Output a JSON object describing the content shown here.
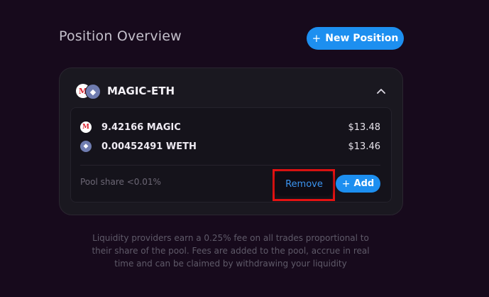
{
  "header": {
    "title": "Position Overview",
    "new_position_label": "New Position",
    "new_position_icon": "+"
  },
  "position": {
    "pair_name": "MAGIC-ETH",
    "tokens": [
      {
        "icon": "magic-icon",
        "glyph": "M",
        "amount": "9.42166 MAGIC",
        "value": "$13.48"
      },
      {
        "icon": "eth-icon",
        "glyph": "◆",
        "amount": "0.00452491 WETH",
        "value": "$13.46"
      }
    ],
    "pool_share": "Pool share <0.01%",
    "remove_label": "Remove",
    "add_label": "Add",
    "add_icon": "+"
  },
  "footnote": "Liquidity providers earn a 0.25% fee on all trades proportional to their share of the pool. Fees are added to the pool, accrue in real time and can be claimed by withdrawing your liquidity",
  "colors": {
    "background": "#170a1c",
    "accent": "#1d8ff0",
    "highlight": "#e51212",
    "magic_red": "#d8202c",
    "eth_purple": "#6f7cb0"
  }
}
